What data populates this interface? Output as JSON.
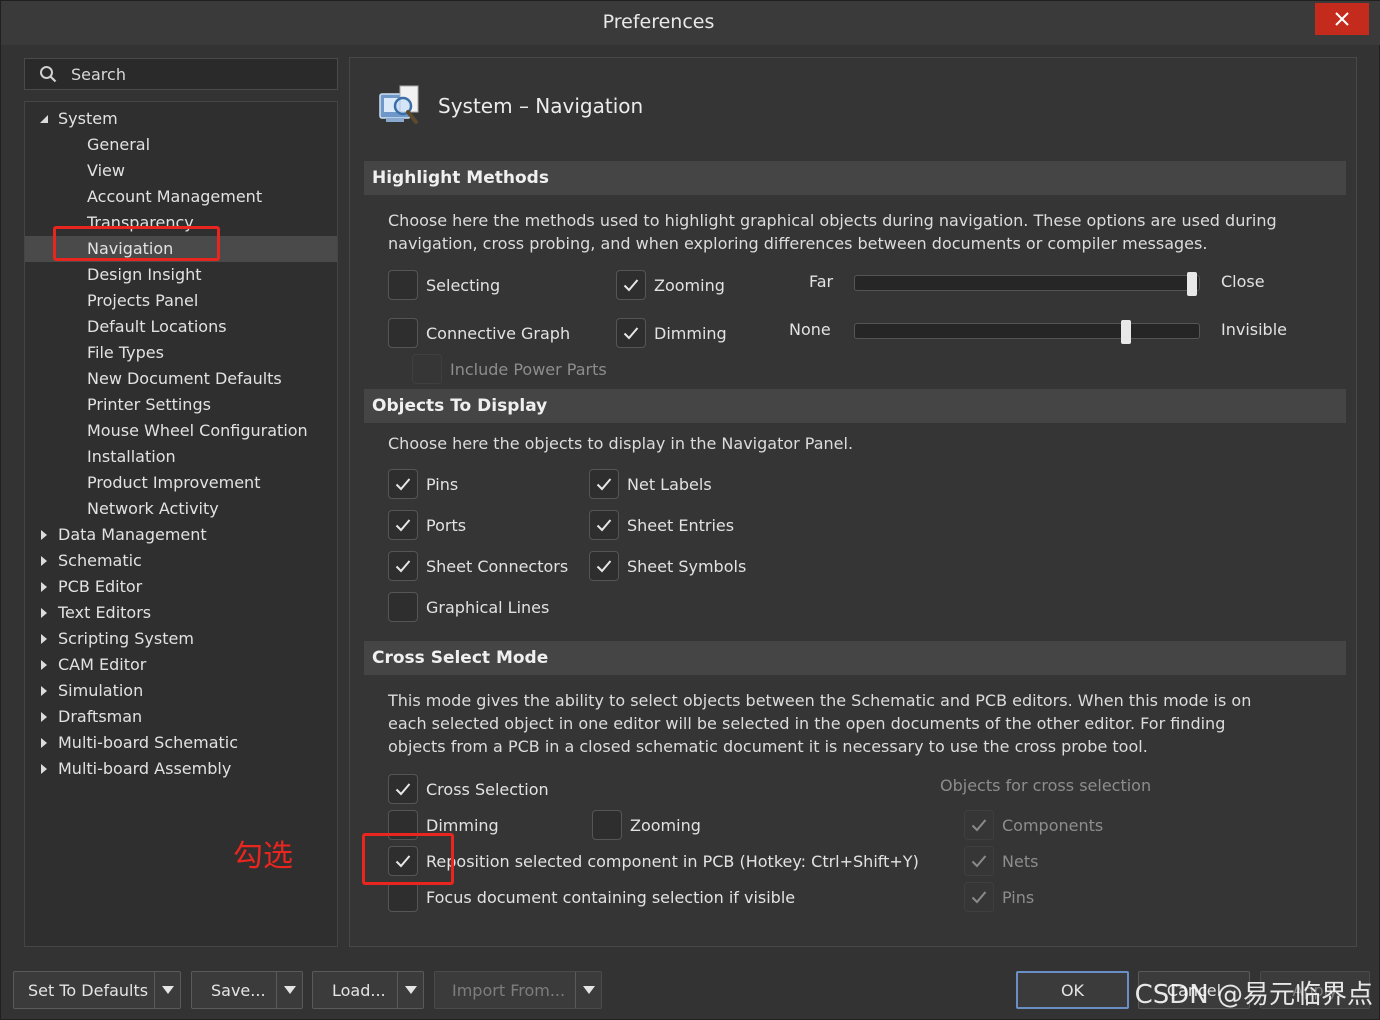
{
  "window": {
    "title": "Preferences"
  },
  "search": {
    "placeholder": "Search"
  },
  "tree": {
    "system_label": "System",
    "system_children": [
      "General",
      "View",
      "Account Management",
      "Transparency",
      "Navigation",
      "Design Insight",
      "Projects Panel",
      "Default Locations",
      "File Types",
      "New Document Defaults",
      "Printer Settings",
      "Mouse Wheel Configuration",
      "Installation",
      "Product Improvement",
      "Network Activity"
    ],
    "selected": "Navigation",
    "top_items": [
      "Data Management",
      "Schematic",
      "PCB Editor",
      "Text Editors",
      "Scripting System",
      "CAM Editor",
      "Simulation",
      "Draftsman",
      "Multi-board Schematic",
      "Multi-board Assembly"
    ]
  },
  "annotation": {
    "text": "勾选",
    "color": "#e8261f"
  },
  "page": {
    "title": "System – Navigation"
  },
  "highlight": {
    "header": "Highlight Methods",
    "description": "Choose here the methods used to highlight graphical objects during navigation. These options are used during navigation, cross probing, and when exploring differences between documents or compiler messages.",
    "selecting": {
      "label": "Selecting",
      "checked": false
    },
    "zooming": {
      "label": "Zooming",
      "checked": true
    },
    "connective": {
      "label": "Connective Graph",
      "checked": false
    },
    "dimming": {
      "label": "Dimming",
      "checked": true
    },
    "power_parts": {
      "label": "Include Power Parts",
      "checked": false,
      "disabled": true
    },
    "zoom_slider": {
      "min_label": "Far",
      "max_label": "Close",
      "value": 1.0
    },
    "dim_slider": {
      "min_label": "None",
      "max_label": "Invisible",
      "value": 0.8
    }
  },
  "objects": {
    "header": "Objects To Display",
    "description": "Choose here the objects to display in the Navigator Panel.",
    "items": [
      {
        "label": "Pins",
        "checked": true
      },
      {
        "label": "Net Labels",
        "checked": true
      },
      {
        "label": "Ports",
        "checked": true
      },
      {
        "label": "Sheet Entries",
        "checked": true
      },
      {
        "label": "Sheet Connectors",
        "checked": true
      },
      {
        "label": "Sheet Symbols",
        "checked": true
      },
      {
        "label": "Graphical Lines",
        "checked": false
      }
    ]
  },
  "cross": {
    "header": "Cross Select Mode",
    "description": "This mode gives the ability to select objects between the Schematic and PCB editors.  When this mode is on each selected object in one editor will be selected in the open documents of the other editor.  For finding objects from a PCB in a closed schematic document it is necessary to use the cross probe tool.",
    "cross_selection": {
      "label": "Cross Selection",
      "checked": true
    },
    "dimming": {
      "label": "Dimming",
      "checked": false
    },
    "zooming": {
      "label": "Zooming",
      "checked": false
    },
    "reposition": {
      "label": "Reposition selected component in PCB (Hotkey: Ctrl+Shift+Y)",
      "checked": true
    },
    "focus": {
      "label": "Focus document containing selection if visible",
      "checked": false
    },
    "objects_header": "Objects for cross selection",
    "components": {
      "label": "Components",
      "checked": true,
      "disabled": true
    },
    "nets": {
      "label": "Nets",
      "checked": true,
      "disabled": true
    },
    "pins": {
      "label": "Pins",
      "checked": true,
      "disabled": true
    }
  },
  "footer": {
    "set_defaults": "Set To Defaults",
    "save": "Save...",
    "load": "Load...",
    "import_from": "Import From...",
    "ok": "OK",
    "cancel": "Cancel",
    "apply": "Apply"
  },
  "watermark": "CSDN @易元临界点"
}
